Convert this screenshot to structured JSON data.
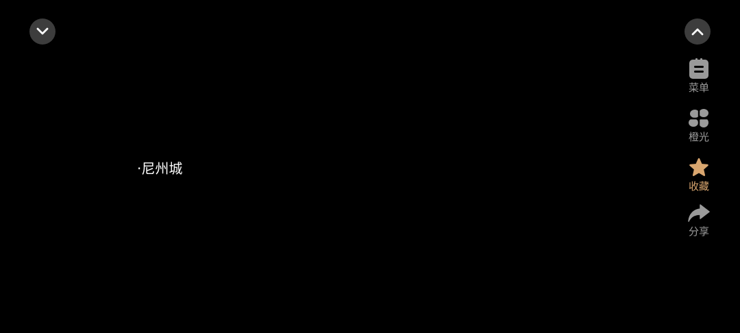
{
  "content": {
    "text": "·尼州城"
  },
  "controls": {
    "collapse_icon": "chevron-down-icon",
    "expand_icon": "chevron-up-icon"
  },
  "sidebar": {
    "items": [
      {
        "label": "菜单",
        "icon": "menu-icon",
        "active": false
      },
      {
        "label": "橙光",
        "icon": "orange-light-logo-icon",
        "active": false
      },
      {
        "label": "收藏",
        "icon": "star-icon",
        "active": true
      },
      {
        "label": "分享",
        "icon": "share-arrow-icon",
        "active": false
      }
    ]
  },
  "colors": {
    "background": "#000000",
    "button_bg": "#3d3d3d",
    "icon_gray": "#9a9a9a",
    "label_gray": "#9a9a9a",
    "accent_gold": "#d9a66f",
    "text_white": "#ffffff"
  }
}
